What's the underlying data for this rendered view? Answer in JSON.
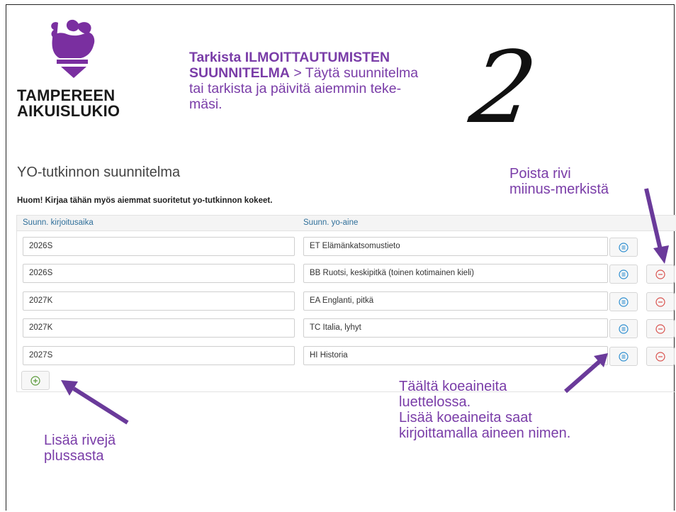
{
  "logo": {
    "line1": "TAMPEREEN",
    "line2": "AIKUISLUKIO"
  },
  "instruction": {
    "bold": "Tarkista ILMOITTAUTUMISTEN SUUNNITELMA",
    "line1_rest": " > Täytä suunnitelma",
    "line2": "tai tarkista ja päivitä aiemmin teke-",
    "line3": "mäsi."
  },
  "step_number": "2",
  "section_title": "YO-tutkinnon suunnitelma",
  "note": "Huom! Kirjaa tähän myös aiemmat suoritetut yo-tutkinnon kokeet.",
  "table": {
    "headers": [
      "Suunn. kirjoitusaika",
      "Suunn. yo-aine"
    ],
    "rows": [
      {
        "time": "2026S",
        "subject": "ET Elämänkatsomustieto",
        "deletable": false
      },
      {
        "time": "2026S",
        "subject": "BB Ruotsi, keskipitkä (toinen kotimainen kieli)",
        "deletable": true
      },
      {
        "time": "2027K",
        "subject": "EA Englanti, pitkä",
        "deletable": true
      },
      {
        "time": "2027K",
        "subject": "TC Italia, lyhyt",
        "deletable": true
      },
      {
        "time": "2027S",
        "subject": "HI Historia",
        "deletable": true
      }
    ]
  },
  "annotations": {
    "delete": [
      "Poista rivi",
      "miinus-merkistä"
    ],
    "subjects": [
      "Täältä koeaineita",
      "luettelossa.",
      "Lisää koeaineita saat",
      "kirjoittamalla aineen nimen."
    ],
    "add": [
      "Lisää rivejä",
      "plussasta"
    ]
  },
  "colors": {
    "annotation": "#7a3da8",
    "accent_blue": "#2f8fd0",
    "delete_red": "#d9534f",
    "add_green": "#5a9a3a"
  },
  "icons": {
    "list": "list-circle-icon",
    "remove": "minus-circle-icon",
    "add": "plus-circle-icon"
  }
}
